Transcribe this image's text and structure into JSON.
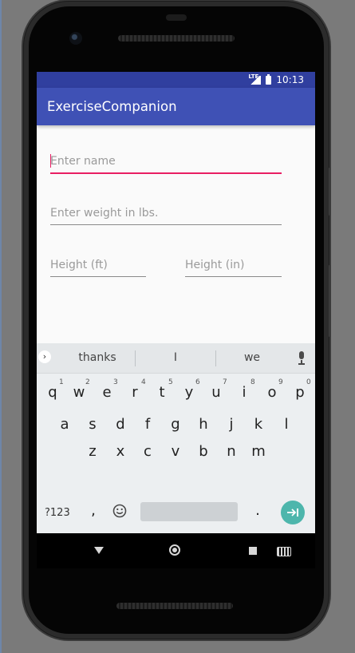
{
  "status_bar": {
    "network": "LTE",
    "time": "10:13"
  },
  "app": {
    "title": "ExerciseCompanion"
  },
  "form": {
    "name": {
      "placeholder": "Enter name",
      "value": ""
    },
    "weight": {
      "placeholder": "Enter weight in lbs.",
      "value": ""
    },
    "height_ft": {
      "placeholder": "Height (ft)",
      "value": ""
    },
    "height_in": {
      "placeholder": "Height (in)",
      "value": ""
    }
  },
  "keyboard": {
    "suggestions": [
      "thanks",
      "I",
      "we"
    ],
    "row1": [
      {
        "key": "q",
        "hint": "1"
      },
      {
        "key": "w",
        "hint": "2"
      },
      {
        "key": "e",
        "hint": "3"
      },
      {
        "key": "r",
        "hint": "4"
      },
      {
        "key": "t",
        "hint": "5"
      },
      {
        "key": "y",
        "hint": "6"
      },
      {
        "key": "u",
        "hint": "7"
      },
      {
        "key": "i",
        "hint": "8"
      },
      {
        "key": "o",
        "hint": "9"
      },
      {
        "key": "p",
        "hint": "0"
      }
    ],
    "row2": [
      "a",
      "s",
      "d",
      "f",
      "g",
      "h",
      "j",
      "k",
      "l"
    ],
    "row3": [
      "z",
      "x",
      "c",
      "v",
      "b",
      "n",
      "m"
    ],
    "symbols_label": "?123",
    "comma": ",",
    "period": ".",
    "accent_color": "#4db6ac"
  },
  "colors": {
    "status_bar": "#303f9f",
    "app_bar": "#3f51b5",
    "focus_underline": "#e91e63"
  },
  "icons": {
    "shift": "shift-icon",
    "backspace": "backspace-icon",
    "emoji": "emoji-icon",
    "mic": "mic-icon",
    "enter": "enter-icon",
    "expand": "chevron-right-icon",
    "nav_back": "back-triangle-icon",
    "nav_home": "home-circle-icon",
    "nav_recents": "recents-square-icon",
    "nav_keyboard": "keyboard-icon"
  }
}
